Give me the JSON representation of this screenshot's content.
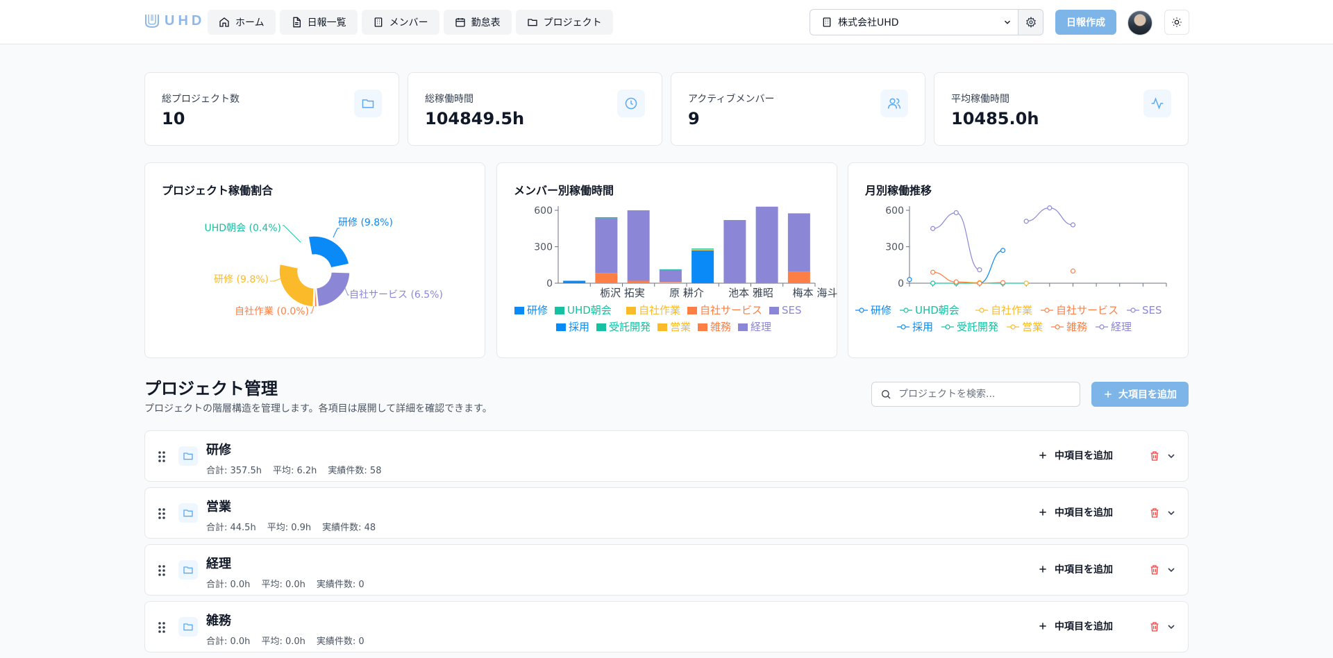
{
  "header": {
    "logo": "UHD",
    "nav": [
      {
        "label": "ホーム",
        "icon": "home-icon"
      },
      {
        "label": "日報一覧",
        "icon": "file-icon"
      },
      {
        "label": "メンバー",
        "icon": "building-icon"
      },
      {
        "label": "勤怠表",
        "icon": "calendar-icon"
      },
      {
        "label": "プロジェクト",
        "icon": "folder-icon"
      }
    ],
    "company": "株式会社UHD",
    "create_label": "日報作成"
  },
  "stats": [
    {
      "label": "総プロジェクト数",
      "value": "10",
      "icon": "folder-icon"
    },
    {
      "label": "総稼働時間",
      "value": "104849.5h",
      "icon": "clock-icon"
    },
    {
      "label": "アクティブメンバー",
      "value": "9",
      "icon": "users-icon"
    },
    {
      "label": "平均稼働時間",
      "value": "10485.0h",
      "icon": "activity-icon"
    }
  ],
  "colors": {
    "blue": "#0a8af7",
    "teal": "#16c0a0",
    "yellow": "#fbba2a",
    "orange": "#fd7f45",
    "purple": "#8b86d6",
    "accent": "#7db5e8"
  },
  "chart_data": [
    {
      "type": "pie",
      "title": "プロジェクト稼働割合",
      "labels": [
        "研修",
        "UHD朝会",
        "研修",
        "自社作業",
        "自社サービス"
      ],
      "percents": [
        9.8,
        0.4,
        9.8,
        0.0,
        6.5
      ],
      "slice_labels": [
        "研修 (9.8%)",
        "UHD朝会 (0.4%)",
        "研修 (9.8%)",
        "自社作業 (0.0%)",
        "自社サービス (6.5%)"
      ],
      "colors": [
        "#0a8af7",
        "#16c0a0",
        "#fbba2a",
        "#fd7f45",
        "#8b86d6"
      ]
    },
    {
      "type": "bar",
      "stacked": true,
      "title": "メンバー別稼働時間",
      "categories": [
        "",
        "栃沢 拓実",
        "",
        "原 耕介",
        "",
        "池本 雅昭",
        "",
        "梅本 海斗"
      ],
      "ylim": [
        0,
        600
      ],
      "yticks": [
        0,
        300,
        600
      ],
      "series": [
        {
          "name": "研修",
          "color": "#0a8af7",
          "values": [
            20,
            0,
            0,
            0,
            270,
            0,
            0,
            0
          ]
        },
        {
          "name": "自社作業",
          "color": "#fbba2a",
          "values": [
            0,
            0,
            0,
            5,
            10,
            0,
            0,
            0
          ]
        },
        {
          "name": "自社サービス",
          "color": "#fd7f45",
          "values": [
            0,
            85,
            20,
            5,
            0,
            0,
            0,
            95
          ]
        },
        {
          "name": "SES",
          "color": "#8b86d6",
          "values": [
            0,
            450,
            580,
            100,
            0,
            520,
            630,
            480
          ]
        },
        {
          "name": "UHD朝会",
          "color": "#16c0a0",
          "values": [
            0,
            8,
            0,
            5,
            5,
            0,
            0,
            0
          ]
        }
      ],
      "legend": [
        {
          "name": "研修",
          "color": "#0a8af7"
        },
        {
          "name": "UHD朝会",
          "color": "#16c0a0"
        },
        {
          "name": "自社作業",
          "color": "#fbba2a"
        },
        {
          "name": "自社サービス",
          "color": "#fd7f45"
        },
        {
          "name": "SES",
          "color": "#8b86d6"
        },
        {
          "name": "採用",
          "color": "#0a8af7"
        },
        {
          "name": "受託開発",
          "color": "#16c0a0"
        },
        {
          "name": "営業",
          "color": "#fbba2a"
        },
        {
          "name": "雑務",
          "color": "#fd7f45"
        },
        {
          "name": "経理",
          "color": "#8b86d6"
        }
      ]
    },
    {
      "type": "line",
      "title": "月別稼働推移",
      "ylim": [
        0,
        600
      ],
      "yticks": [
        0,
        300,
        600
      ],
      "x": [
        1,
        2,
        3,
        4,
        5,
        6,
        7,
        8,
        9,
        10,
        11,
        12
      ],
      "series": [
        {
          "name": "研修",
          "color": "#0a8af7",
          "values": [
            30,
            null,
            null,
            0,
            270,
            null,
            null,
            null,
            null,
            null,
            null,
            null
          ]
        },
        {
          "name": "UHD朝会",
          "color": "#16c0a0",
          "values": [
            null,
            0,
            0,
            0,
            0,
            0,
            null,
            null,
            null,
            null,
            null,
            null
          ]
        },
        {
          "name": "自社作業",
          "color": "#fbba2a",
          "values": [
            null,
            null,
            10,
            5,
            null,
            0,
            null,
            null,
            null,
            null,
            null,
            null
          ]
        },
        {
          "name": "自社サービス",
          "color": "#fd7f45",
          "values": [
            null,
            90,
            10,
            0,
            5,
            null,
            null,
            100,
            null,
            null,
            null,
            null
          ]
        },
        {
          "name": "SES",
          "color": "#8b86d6",
          "values": [
            null,
            450,
            580,
            110,
            null,
            510,
            620,
            480,
            null,
            null,
            null,
            null
          ]
        }
      ],
      "legend": [
        {
          "name": "研修",
          "color": "#0a8af7"
        },
        {
          "name": "UHD朝会",
          "color": "#16c0a0"
        },
        {
          "name": "自社作業",
          "color": "#fbba2a"
        },
        {
          "name": "自社サービス",
          "color": "#fd7f45"
        },
        {
          "name": "SES",
          "color": "#8b86d6"
        },
        {
          "name": "採用",
          "color": "#0a8af7"
        },
        {
          "name": "受託開発",
          "color": "#16c0a0"
        },
        {
          "name": "営業",
          "color": "#fbba2a"
        },
        {
          "name": "雑務",
          "color": "#fd7f45"
        },
        {
          "name": "経理",
          "color": "#8b86d6"
        }
      ]
    }
  ],
  "projects_section": {
    "title": "プロジェクト管理",
    "subtitle": "プロジェクトの階層構造を管理します。各項目は展開して詳細を確認できます。",
    "search_placeholder": "プロジェクトを検索...",
    "add_major_label": "大項目を追加",
    "add_mid_label": "中項目を追加",
    "rows": [
      {
        "name": "研修",
        "total": "合計: 357.5h",
        "avg": "平均: 6.2h",
        "count": "実績件数: 58"
      },
      {
        "name": "営業",
        "total": "合計: 44.5h",
        "avg": "平均: 0.9h",
        "count": "実績件数: 48"
      },
      {
        "name": "経理",
        "total": "合計: 0.0h",
        "avg": "平均: 0.0h",
        "count": "実績件数: 0"
      },
      {
        "name": "雑務",
        "total": "合計: 0.0h",
        "avg": "平均: 0.0h",
        "count": "実績件数: 0"
      }
    ]
  }
}
